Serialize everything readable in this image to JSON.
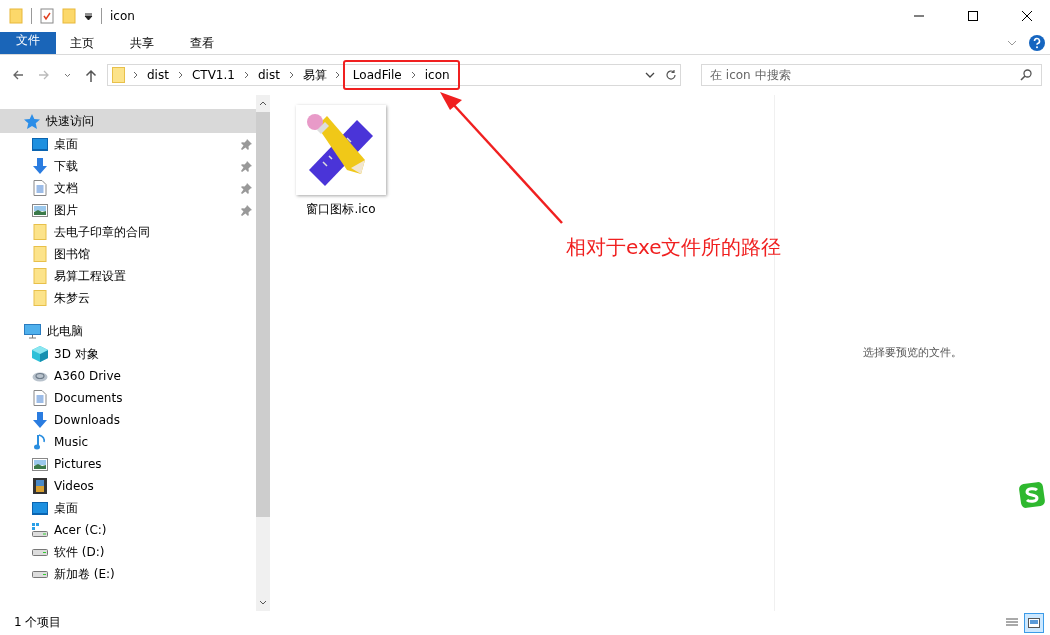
{
  "window": {
    "title": "icon"
  },
  "ribbon_tabs": [
    {
      "label": "文件",
      "kind": "file"
    },
    {
      "label": "主页",
      "kind": "tab"
    },
    {
      "label": "共享",
      "kind": "tab"
    },
    {
      "label": "查看",
      "kind": "tab"
    }
  ],
  "breadcrumbs": [
    {
      "label": "dist",
      "highlighted": false
    },
    {
      "label": "CTV1.1",
      "highlighted": false
    },
    {
      "label": "dist",
      "highlighted": false
    },
    {
      "label": "易算",
      "highlighted": false
    },
    {
      "label": "LoadFile",
      "highlighted": true
    },
    {
      "label": "icon",
      "highlighted": true
    }
  ],
  "search": {
    "placeholder": "在 icon 中搜索"
  },
  "nav": [
    {
      "label": "快速访问",
      "kind": "star",
      "selected": true,
      "children": [
        {
          "label": "桌面",
          "kind": "desktop",
          "pinned": true,
          "selected": false
        },
        {
          "label": "下载",
          "kind": "download",
          "pinned": true,
          "selected": false
        },
        {
          "label": "文档",
          "kind": "document",
          "pinned": true,
          "selected": false
        },
        {
          "label": "图片",
          "kind": "picture",
          "pinned": true,
          "selected": false
        },
        {
          "label": "去电子印章的合同",
          "kind": "folder",
          "pinned": false,
          "selected": false
        },
        {
          "label": "图书馆",
          "kind": "folder",
          "pinned": false,
          "selected": false
        },
        {
          "label": "易算工程设置",
          "kind": "folder",
          "pinned": false,
          "selected": false
        },
        {
          "label": "朱梦云",
          "kind": "folder",
          "pinned": false,
          "selected": false
        }
      ]
    },
    {
      "label": "此电脑",
      "kind": "pc",
      "selected": false,
      "children": [
        {
          "label": "3D 对象",
          "kind": "cube",
          "pinned": false,
          "selected": false
        },
        {
          "label": "A360 Drive",
          "kind": "cloud",
          "pinned": false,
          "selected": false
        },
        {
          "label": "Documents",
          "kind": "document",
          "pinned": false,
          "selected": false
        },
        {
          "label": "Downloads",
          "kind": "download",
          "pinned": false,
          "selected": false
        },
        {
          "label": "Music",
          "kind": "music",
          "pinned": false,
          "selected": false
        },
        {
          "label": "Pictures",
          "kind": "picture",
          "pinned": false,
          "selected": false
        },
        {
          "label": "Videos",
          "kind": "video",
          "pinned": false,
          "selected": false
        },
        {
          "label": "桌面",
          "kind": "desktop",
          "pinned": false,
          "selected": false
        },
        {
          "label": "Acer (C:)",
          "kind": "windrive",
          "pinned": false,
          "selected": false
        },
        {
          "label": "软件 (D:)",
          "kind": "drive",
          "pinned": false,
          "selected": false
        },
        {
          "label": "新加卷 (E:)",
          "kind": "drive",
          "pinned": false,
          "selected": false
        }
      ]
    }
  ],
  "files": [
    {
      "name": "窗口图标.ico"
    }
  ],
  "preview": {
    "message": "选择要预览的文件。"
  },
  "annotation": {
    "text": "相对于exe文件所的路径"
  },
  "status_bar": {
    "count": "1 个项目"
  },
  "view_buttons": [
    {
      "selected": false
    },
    {
      "selected": true
    }
  ]
}
